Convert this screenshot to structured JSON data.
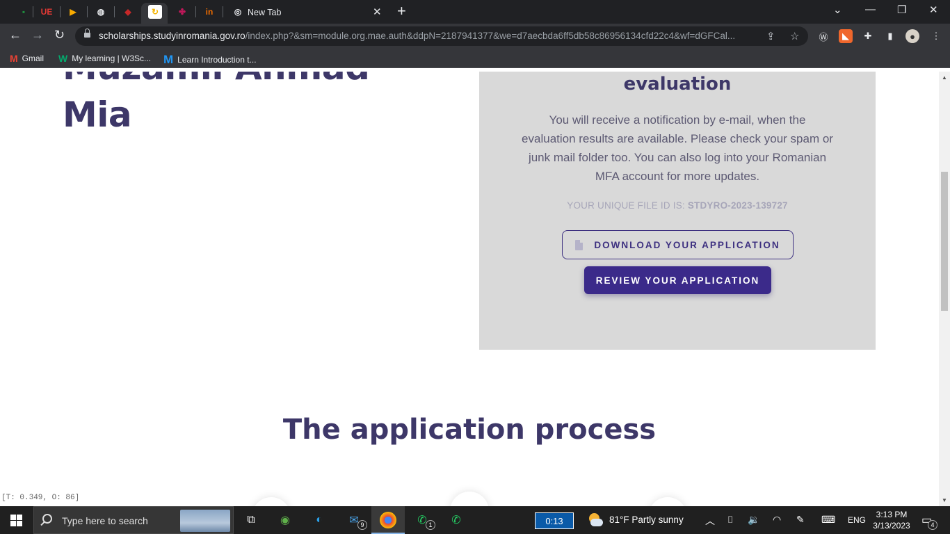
{
  "browser": {
    "tabs": {
      "new_tab_title": "New Tab",
      "close_glyph": "✕",
      "new_tab_glyph": "+",
      "pinned": [
        {
          "name": "sheets-icon",
          "glyph": "▪",
          "color": "#1e8e3e"
        },
        {
          "name": "ue-icon",
          "glyph": "UE",
          "color": "#e53935"
        },
        {
          "name": "drive-icon",
          "glyph": "▶",
          "color": "#f9ab00"
        },
        {
          "name": "globe-icon",
          "glyph": "🌐",
          "color": "#e8eaed"
        },
        {
          "name": "red-shield-icon",
          "glyph": "◆",
          "color": "#c62828"
        },
        {
          "name": "active-tab-icon",
          "glyph": "↻",
          "color": "#f4b400"
        },
        {
          "name": "clover-icon",
          "glyph": "✤",
          "color": "#c2185b"
        },
        {
          "name": "in-icon",
          "glyph": "in",
          "color": "#ef6c00"
        }
      ]
    },
    "window_controls": {
      "dropdown": "⌄",
      "minimize": "—",
      "restore": "❐",
      "close": "✕"
    },
    "address": {
      "host": "scholarships.studyinromania.gov.ro",
      "path": "/index.php?&sm=module.org.mae.auth&ddpN=2187941377&we=d7aecbda6ff5db58c86956134cfd22c4&wf=dGFCal..."
    },
    "bookmarks": [
      {
        "label": "Gmail",
        "icon": "M",
        "color": "#ea4335"
      },
      {
        "label": "My learning | W3Sc...",
        "icon": "W",
        "color": "#04aa6d"
      },
      {
        "label": "Learn Introduction t...",
        "icon": "M",
        "color": "#2196f3"
      }
    ]
  },
  "page": {
    "name_lines": [
      "Muzamil Ahmad",
      "Mia"
    ],
    "card": {
      "title": "evaluation",
      "body": "You will receive a notification by e-mail, when the evaluation results are available. Please check your spam or junk mail folder too. You can also log into your Romanian MFA account for more updates.",
      "file_id_label": "YOUR UNIQUE FILE ID IS:",
      "file_id": "STDYRO-2023-139727",
      "download_button": "DOWNLOAD YOUR APPLICATION",
      "review_button": "REVIEW YOUR APPLICATION"
    },
    "section_title": "The application process",
    "status_text": "[T: 0.349, O: 86]"
  },
  "taskbar": {
    "search_placeholder": "Type here to search",
    "mail_badge": "9",
    "whatsapp_badge": "1",
    "timer": "0:13",
    "weather": "81°F  Partly sunny",
    "language": "ENG",
    "time": "3:13 PM",
    "date": "3/13/2023",
    "notifications": "4"
  }
}
